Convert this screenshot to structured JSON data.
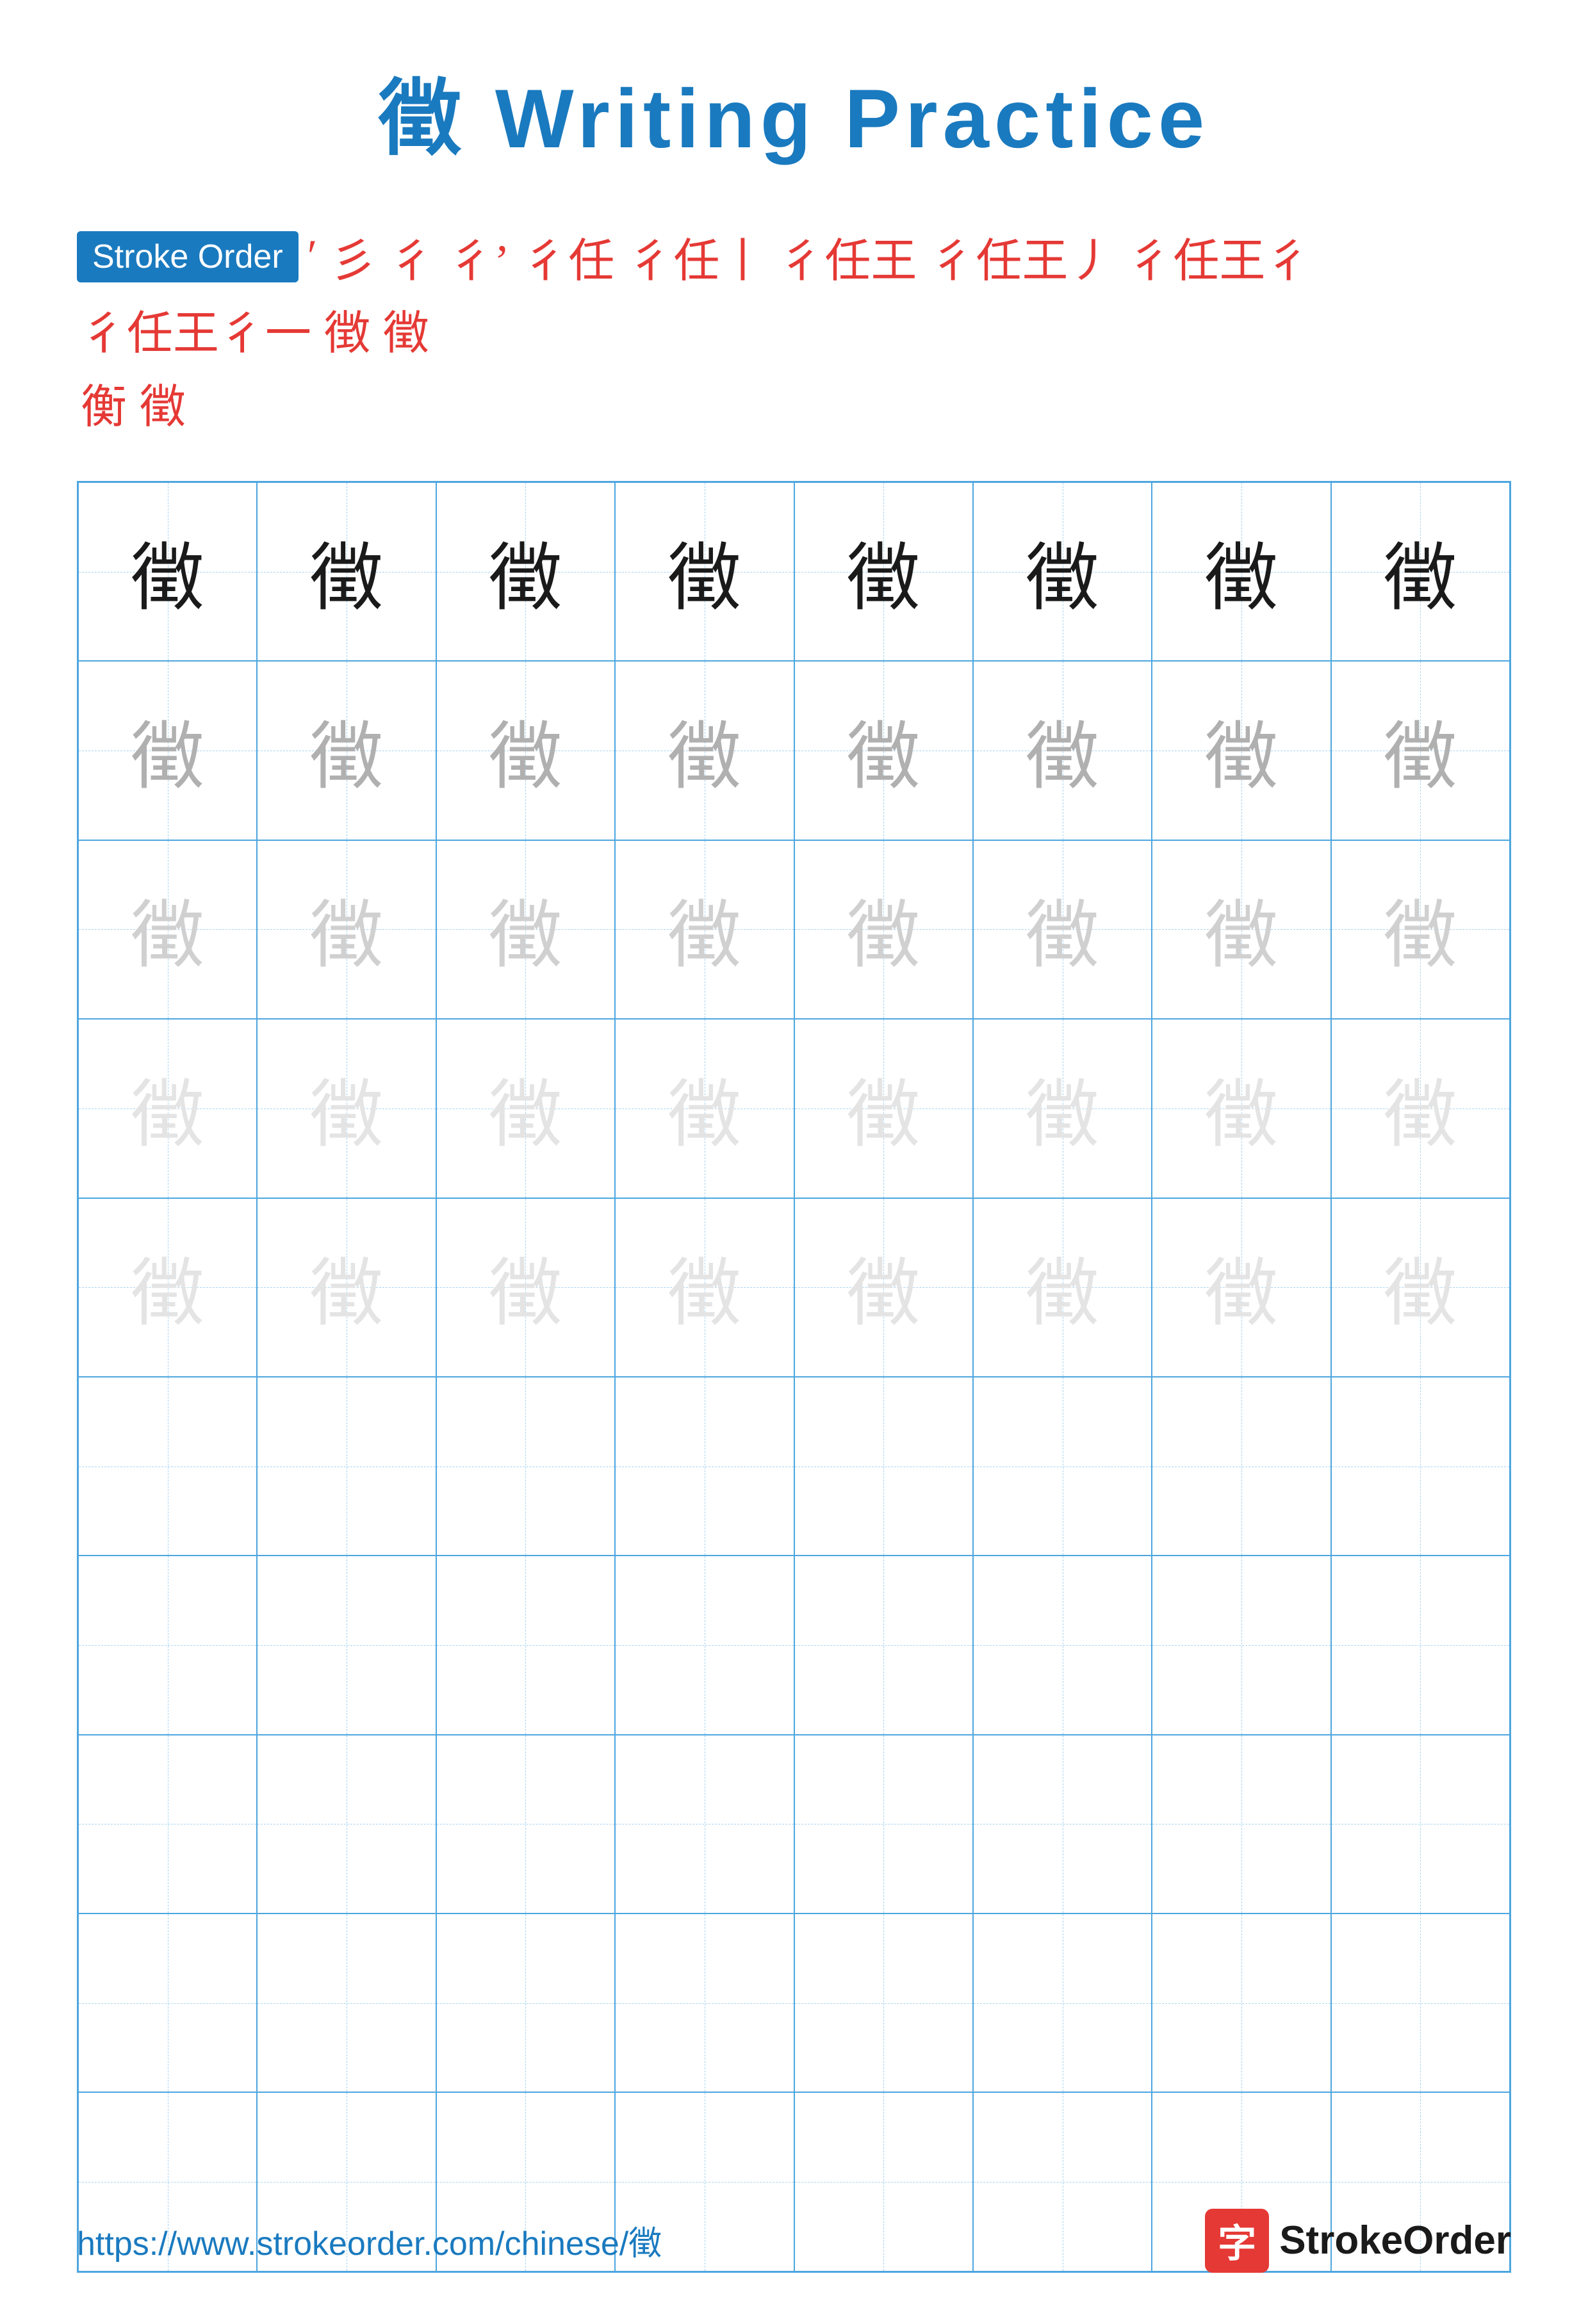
{
  "page": {
    "title": "徵 Writing Practice",
    "title_char": "徵",
    "title_label": "Writing Practice"
  },
  "stroke_order": {
    "badge_label": "Stroke Order",
    "strokes": [
      "'",
      "㇂",
      "㇀",
      "彳'",
      "彳㇀",
      "彳㇀㇁",
      "彳㇀㇁㇃",
      "彳㇀㇁㇃㇄",
      "彳㇀㇁㇃㇄㇅",
      "彳㇀㇁㇃㇄㇅㇆",
      "徴",
      "徵"
    ],
    "stroke_chars": [
      "'",
      "彡",
      "彳",
      "彳'",
      "彳亻",
      "彳亻丨",
      "彳亻王",
      "彳亻王丿",
      "彳亻王彳",
      "彳亻王彳㇀",
      "徴",
      "徵"
    ],
    "row2": [
      "衔",
      "徵"
    ]
  },
  "main_char": "徵",
  "grid": {
    "rows": 10,
    "cols": 8,
    "practice_rows_with_char": 5,
    "opacity_levels": [
      "dark",
      "medium",
      "light",
      "very-light",
      "very-light"
    ]
  },
  "footer": {
    "url": "https://www.strokeorder.com/chinese/徵",
    "logo_char": "字",
    "logo_text": "StrokeOrder"
  }
}
